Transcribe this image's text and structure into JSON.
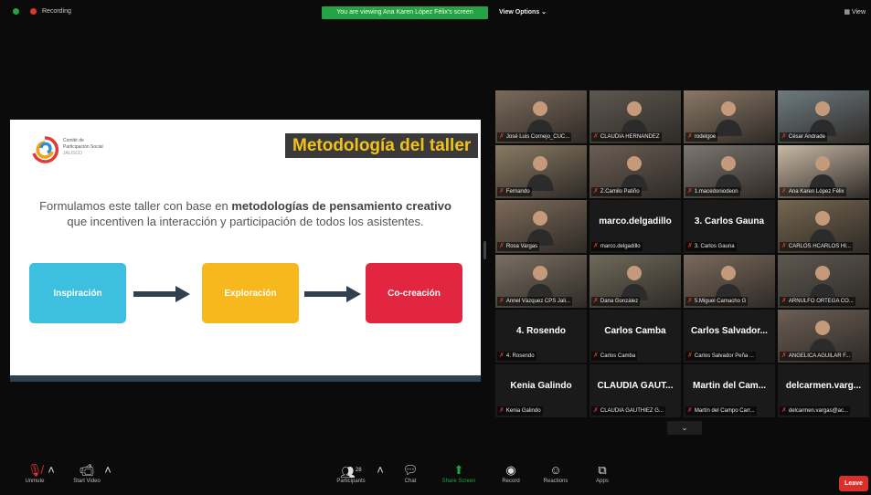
{
  "topbar": {
    "recording_label": "Recording",
    "share_banner": "You are viewing Ana Karen López Félix's screen",
    "view_options": "View Options ⌄",
    "view_button": "View"
  },
  "slide": {
    "org_line1": "Comité de",
    "org_line2": "Participación Social",
    "org_line3": "JALISCO",
    "title": "Metodología del taller",
    "body_pre": "Formulamos este taller con base en ",
    "body_bold": "metodologías de pensamiento creativo",
    "body_post": " que incentiven la interacción y participación de todos los asistentes.",
    "step1": "Inspiración",
    "step2": "Exploración",
    "step3": "Co-creación",
    "step1_color": "#3dbfe0",
    "step2_color": "#f7b81e",
    "step3_color": "#e2263f"
  },
  "participants": [
    {
      "label": "José Luis Cornejo_CUC...",
      "video": true
    },
    {
      "label": "CLAUDIA HERNANDEZ",
      "video": true
    },
    {
      "label": "rodelgoe",
      "video": true
    },
    {
      "label": "César Andrade",
      "video": true
    },
    {
      "label": "Fernando",
      "video": true
    },
    {
      "label": "Z.Camilo Patiño",
      "video": true
    },
    {
      "label": "1.macedoniodeon",
      "video": true
    },
    {
      "label": "Ana Karen López Félix",
      "video": true,
      "active": true
    },
    {
      "label": "Rosa Vargas",
      "video": true
    },
    {
      "label": "marco.delgadillo",
      "big": "marco.delgadillo"
    },
    {
      "label": "3. Carlos Gauna",
      "big": "3. Carlos Gauna"
    },
    {
      "label": "CARLOS HCARLOS HI...",
      "video": true
    },
    {
      "label": "Annel Vázquez CPS Jali...",
      "video": true
    },
    {
      "label": "Dana González",
      "video": true
    },
    {
      "label": "5.Miguel Camacho G",
      "video": true
    },
    {
      "label": "ARNULFO ORTEGA CO...",
      "video": true
    },
    {
      "label": "4. Rosendo",
      "big": "4. Rosendo"
    },
    {
      "label": "Carlos Camba",
      "big": "Carlos Camba"
    },
    {
      "label": "Carlos Salvador Peña ...",
      "big": "Carlos Salvador..."
    },
    {
      "label": "ANGELICA AGUILAR F...",
      "video": true
    },
    {
      "label": "Kenia Galindo",
      "big": "Kenia Galindo"
    },
    {
      "label": "CLAUDIA GAUTHIEZ G...",
      "big": "CLAUDIA GAUT..."
    },
    {
      "label": "Martín del Campo Carr...",
      "big": "Martin del Cam..."
    },
    {
      "label": "delcarmen.vargas@ac...",
      "big": "delcarmen.varg..."
    }
  ],
  "toolbar": {
    "unmute": "Unmute",
    "start_video": "Start Video",
    "participants": "Participants",
    "participant_count": "28",
    "chat": "Chat",
    "share_screen": "Share Screen",
    "record": "Record",
    "reactions": "Reactions",
    "apps": "Apps",
    "leave": "Leave"
  },
  "colors": {
    "share_green": "#25a244",
    "leave_red": "#d9302a",
    "active_speaker": "#c7d44a"
  }
}
